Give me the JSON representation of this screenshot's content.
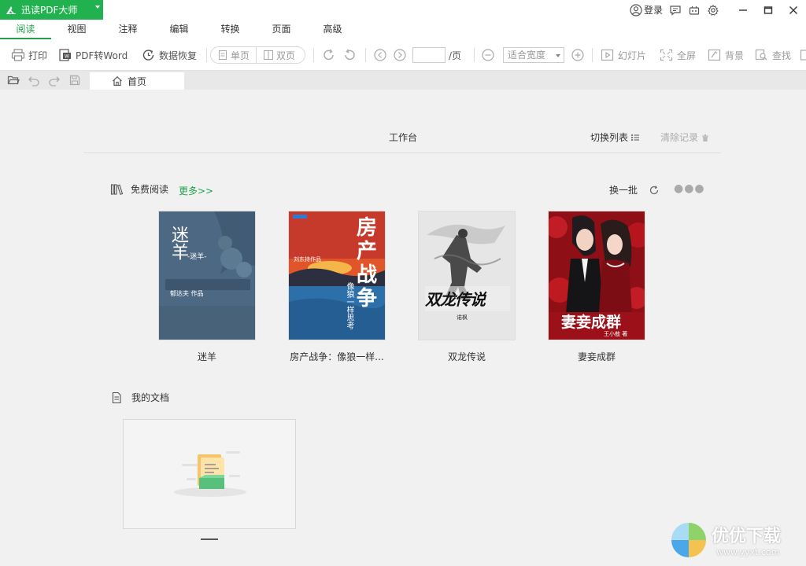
{
  "app": {
    "title": "迅读PDF大师"
  },
  "titlebar": {
    "login_label": "登录"
  },
  "menu": {
    "tabs": [
      "阅读",
      "视图",
      "注释",
      "编辑",
      "转换",
      "页面",
      "高级"
    ],
    "active_index": 0
  },
  "toolbar": {
    "print": "打印",
    "pdf_to_word": "PDF转Word",
    "data_recovery": "数据恢复",
    "single_page": "单页",
    "double_page": "双页",
    "page_suffix": "/页",
    "zoom_value": "适合宽度",
    "slideshow": "幻灯片",
    "fullscreen": "全屏",
    "background": "背景",
    "find": "查找"
  },
  "doc_tabs": {
    "home": "首页"
  },
  "workbench": {
    "title": "工作台",
    "switch_list": "切换列表",
    "clear_record": "清除记录"
  },
  "free_reading": {
    "title": "免费阅读",
    "more": "更多>>",
    "refresh": "换一批",
    "books": [
      {
        "title": "迷羊",
        "cover_text": "迷羊",
        "cover_sub": "-迷羊-",
        "cover_author": "郁达夫 作品",
        "cover_color": "#4f6a83"
      },
      {
        "title": "房产战争：像狼一样...",
        "cover_text": "房产战争",
        "cover_sub": "像狼一样思考",
        "cover_author": "刘东持作品",
        "cover_color": "#c8322b"
      },
      {
        "title": "双龙传说",
        "cover_text": "双龙传说",
        "cover_sub": "",
        "cover_author": "诺枫",
        "cover_color": "#e9e9e9"
      },
      {
        "title": "妻妾成群",
        "cover_text": "妻妾成群",
        "cover_sub": "",
        "cover_author": "王小敖 著",
        "cover_color": "#a8141c"
      }
    ]
  },
  "my_docs": {
    "title": "我的文档"
  },
  "watermark": {
    "brand": "优优下载",
    "url": "www.yyxt.com"
  }
}
